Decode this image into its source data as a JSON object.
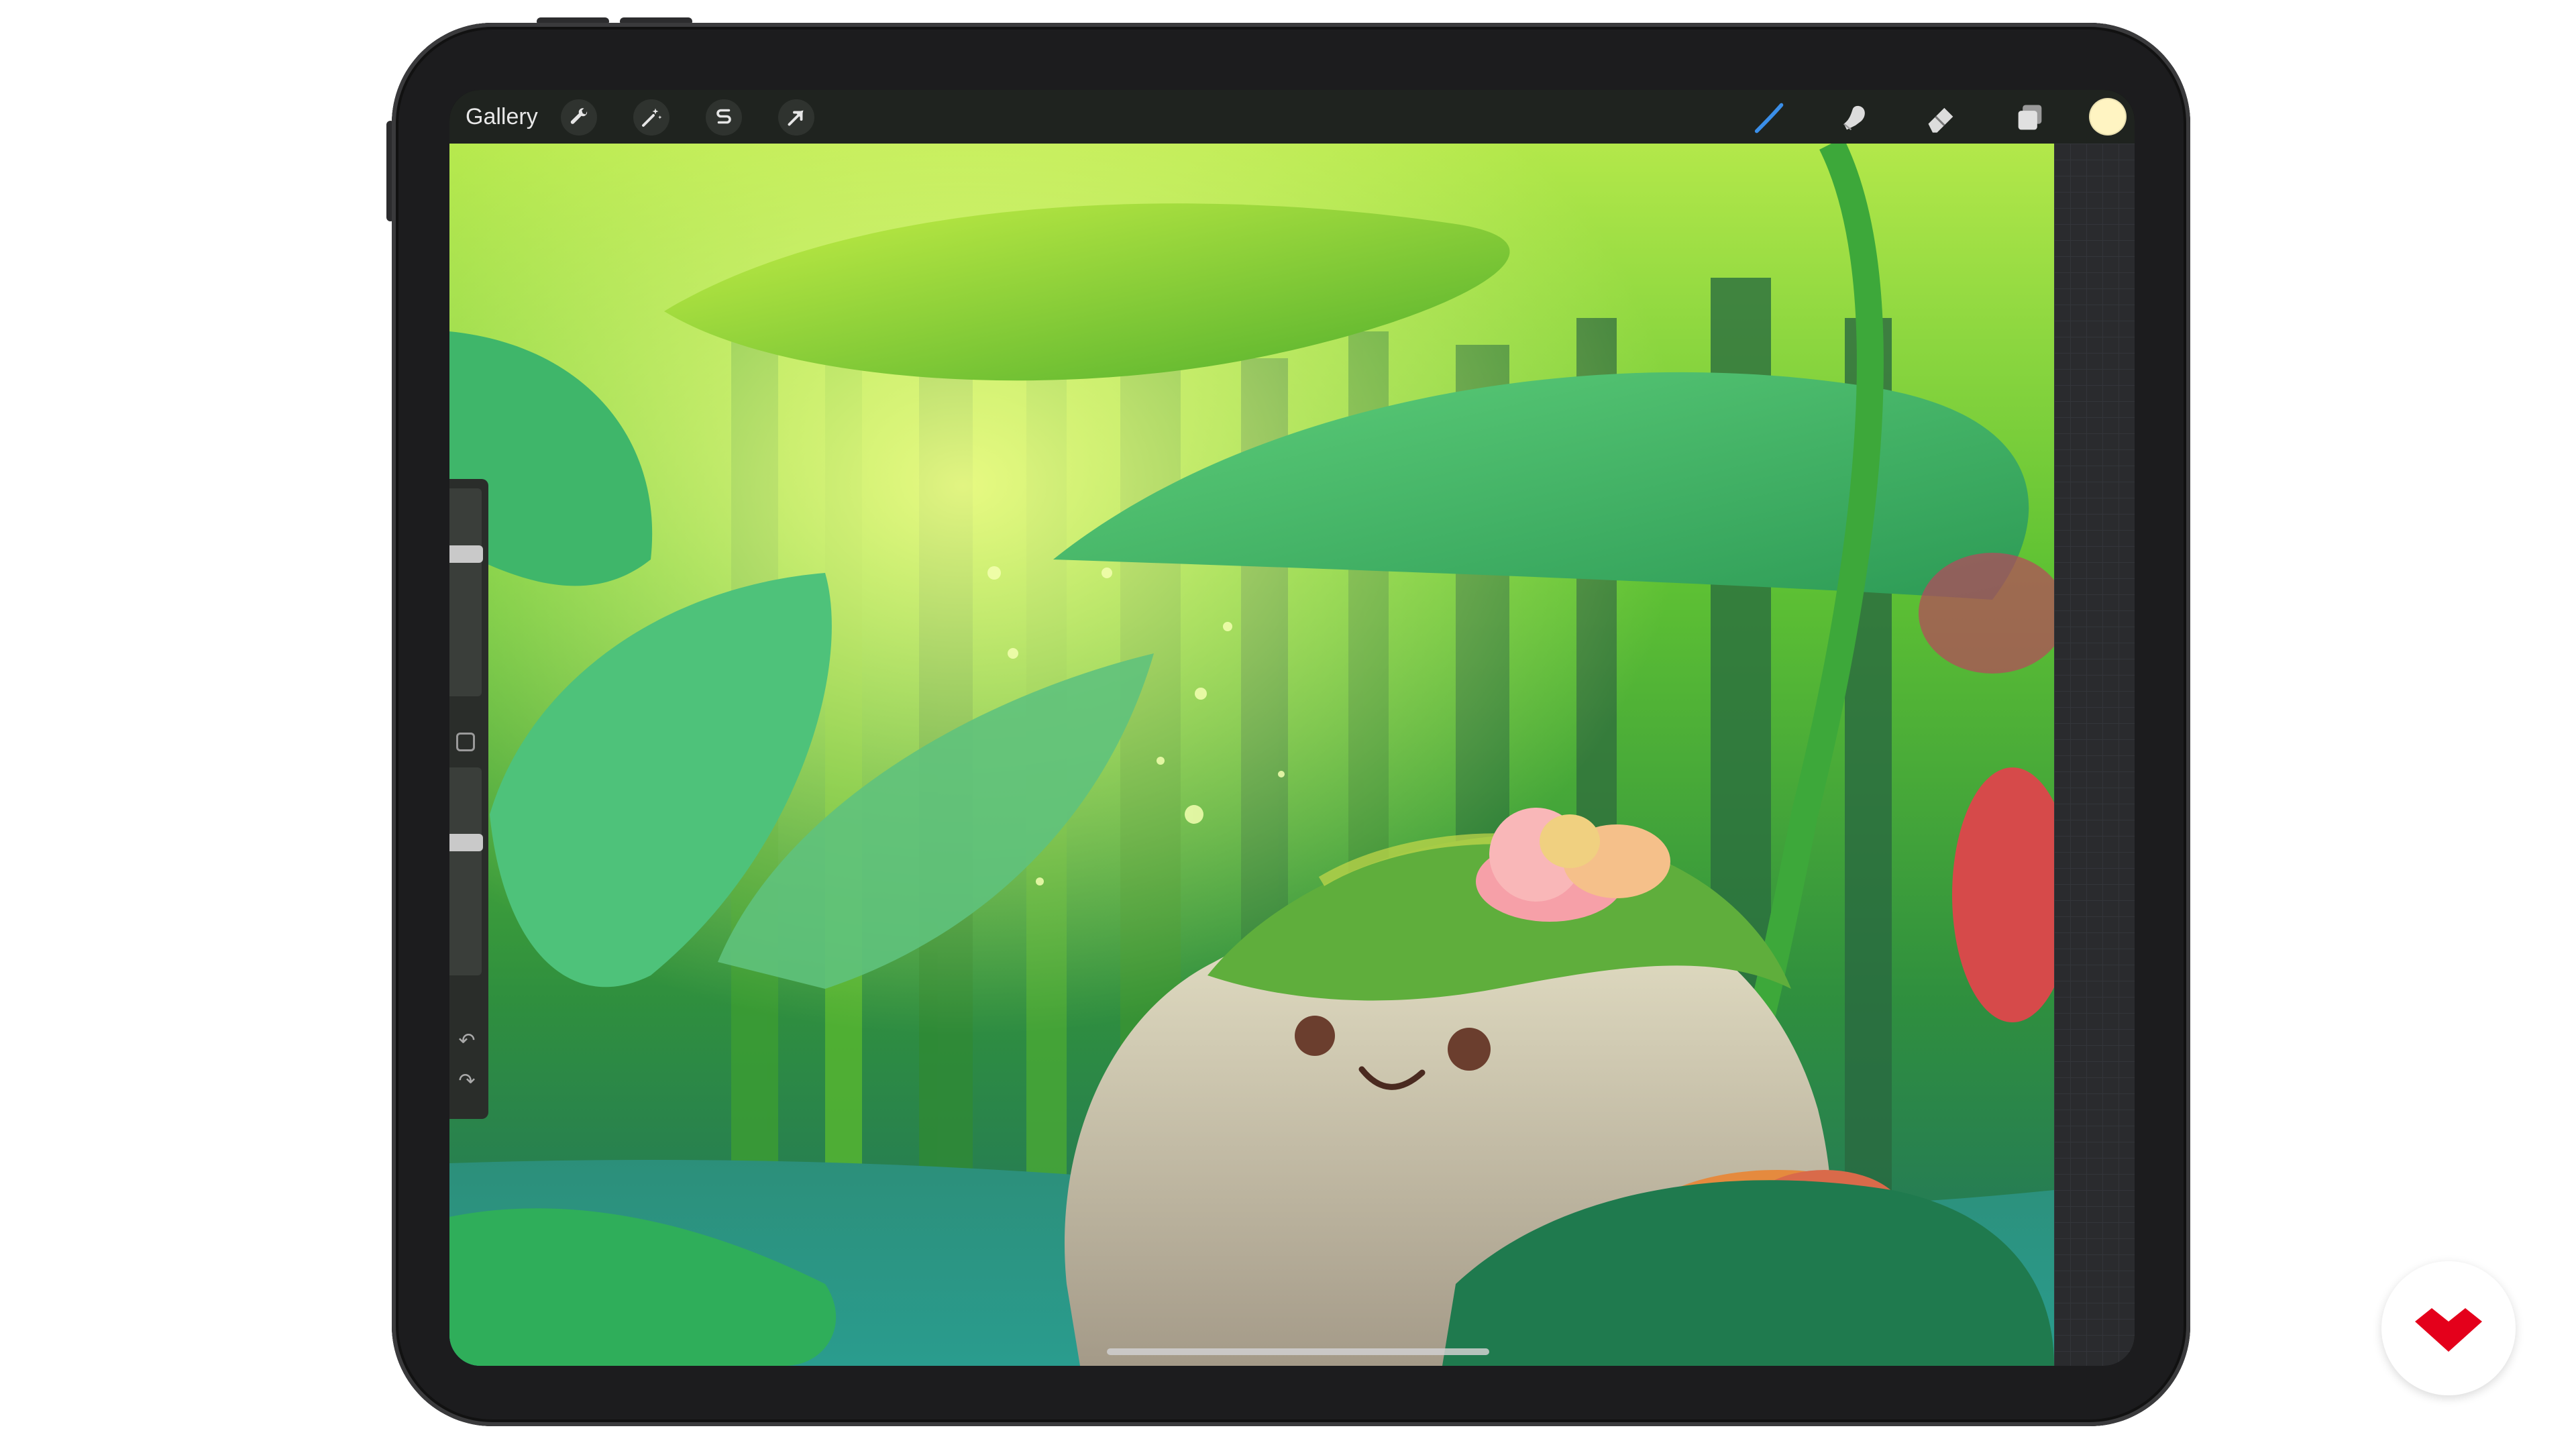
{
  "toolbar": {
    "gallery_label": "Gallery",
    "left_tools": [
      {
        "name": "actions",
        "icon": "wrench-icon"
      },
      {
        "name": "adjustments",
        "icon": "magic-wand-icon"
      },
      {
        "name": "selection",
        "icon": "selection-s-icon"
      },
      {
        "name": "transform",
        "icon": "arrow-cursor-icon"
      }
    ],
    "right_tools": [
      {
        "name": "brush",
        "icon": "brush-icon",
        "active": true,
        "color": "#3a8ee8"
      },
      {
        "name": "smudge",
        "icon": "smudge-finger-icon"
      },
      {
        "name": "eraser",
        "icon": "eraser-icon"
      },
      {
        "name": "layers",
        "icon": "layers-icon"
      }
    ],
    "current_color": "#fff4c2"
  },
  "sidebar": {
    "brush_size_level": 0.3,
    "opacity_level": 0.65,
    "undo_icon": "undo-icon",
    "redo_icon": "redo-icon"
  },
  "canvas": {
    "artwork": "illustration-forest-rock-character"
  },
  "branding": {
    "logo": "domestika-logo",
    "logo_color": "#e4001b"
  }
}
